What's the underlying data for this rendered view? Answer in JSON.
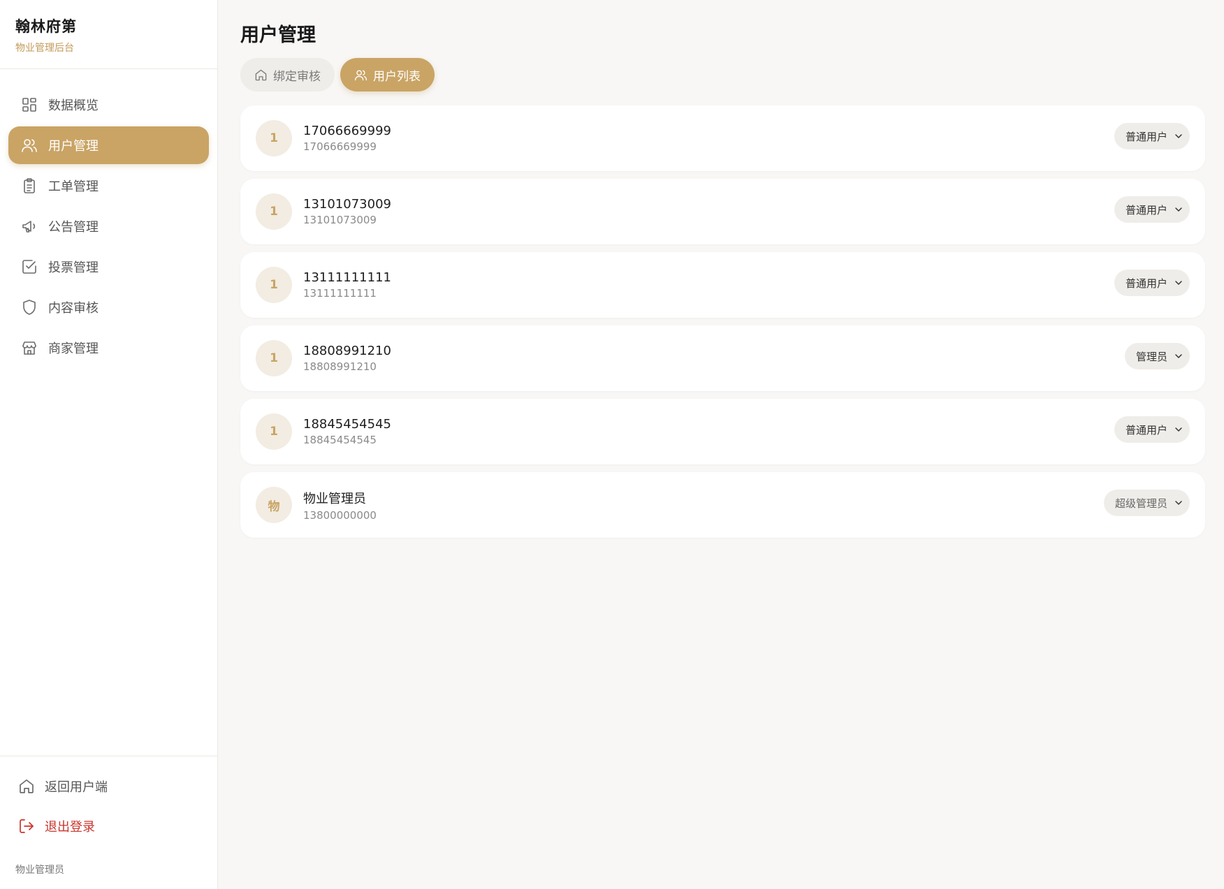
{
  "brand": {
    "title": "翰林府第",
    "subtitle": "物业管理后台"
  },
  "sidebar": {
    "items": [
      {
        "label": "数据概览",
        "icon": "grid-icon",
        "active": false
      },
      {
        "label": "用户管理",
        "icon": "users-icon",
        "active": true
      },
      {
        "label": "工单管理",
        "icon": "clipboard-icon",
        "active": false
      },
      {
        "label": "公告管理",
        "icon": "megaphone-icon",
        "active": false
      },
      {
        "label": "投票管理",
        "icon": "checkbox-icon",
        "active": false
      },
      {
        "label": "内容审核",
        "icon": "shield-icon",
        "active": false
      },
      {
        "label": "商家管理",
        "icon": "store-icon",
        "active": false
      }
    ],
    "back_label": "返回用户端",
    "logout_label": "退出登录",
    "current_user": "物业管理员"
  },
  "main": {
    "title": "用户管理",
    "tabs": [
      {
        "label": "绑定审核",
        "icon": "home-icon",
        "active": false
      },
      {
        "label": "用户列表",
        "icon": "users-icon",
        "active": true
      }
    ],
    "users": [
      {
        "avatar": "1",
        "name": "17066669999",
        "phone": "17066669999",
        "role": "普通用户"
      },
      {
        "avatar": "1",
        "name": "13101073009",
        "phone": "13101073009",
        "role": "普通用户"
      },
      {
        "avatar": "1",
        "name": "13111111111",
        "phone": "13111111111",
        "role": "普通用户"
      },
      {
        "avatar": "1",
        "name": "18808991210",
        "phone": "18808991210",
        "role": "管理员"
      },
      {
        "avatar": "1",
        "name": "18845454545",
        "phone": "18845454545",
        "role": "普通用户"
      },
      {
        "avatar": "物",
        "name": "物业管理员",
        "phone": "13800000000",
        "role": "超级管理员"
      }
    ]
  },
  "colors": {
    "accent": "#c9a465",
    "logout": "#c9352c",
    "background": "#f8f7f5"
  }
}
